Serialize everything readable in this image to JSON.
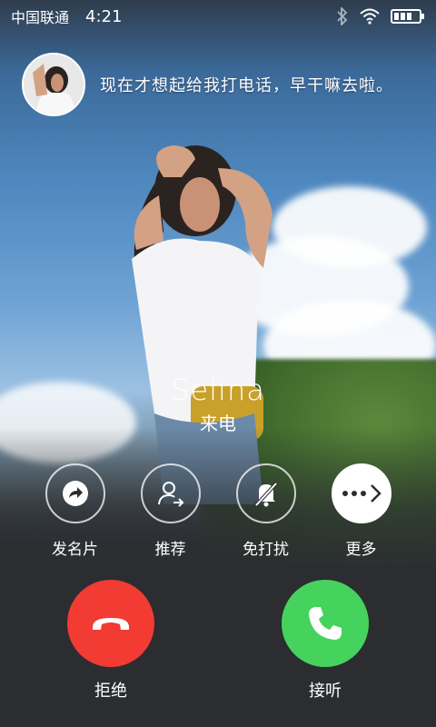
{
  "status_bar": {
    "carrier": "中国联通",
    "time": "4:21",
    "icons": [
      "bluetooth-icon",
      "wifi-icon",
      "battery-icon"
    ]
  },
  "message": {
    "text": "现在才想起给我打电话，早干嘛去啦。"
  },
  "caller": {
    "name": "Selina",
    "status": "来电"
  },
  "actions": [
    {
      "label": "发名片",
      "icon": "share-card-icon"
    },
    {
      "label": "推荐",
      "icon": "recommend-contact-icon"
    },
    {
      "label": "免打扰",
      "icon": "do-not-disturb-icon"
    },
    {
      "label": "更多",
      "icon": "more-icon"
    }
  ],
  "call_buttons": {
    "decline_label": "拒绝",
    "accept_label": "接听"
  },
  "colors": {
    "decline": "#f23b33",
    "accept": "#46d35d",
    "background": "#2b2d31"
  }
}
